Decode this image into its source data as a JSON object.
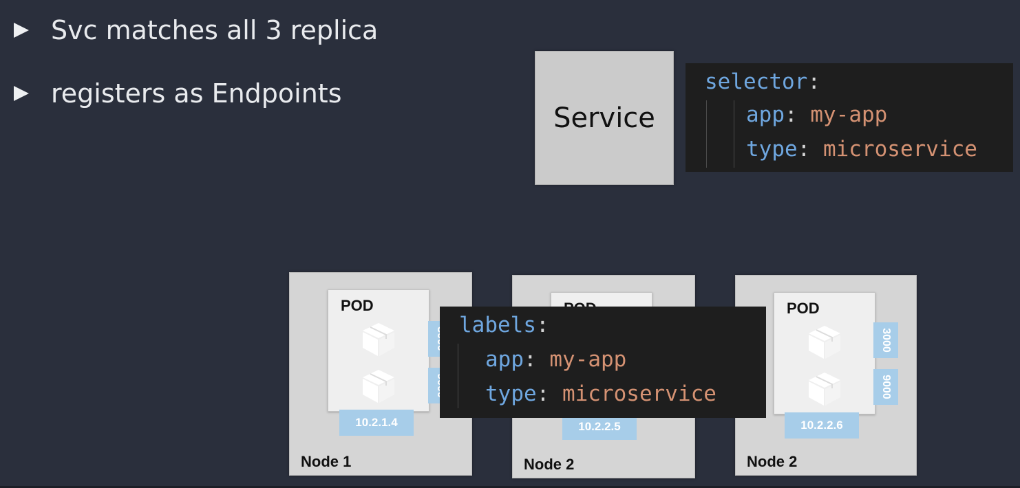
{
  "bullets": [
    {
      "text": "Svc matches all 3 replica"
    },
    {
      "text": "registers as Endpoints"
    }
  ],
  "service": {
    "label": "Service"
  },
  "selector_code": {
    "root_key": "selector",
    "app_key": "app",
    "app_value": "my-app",
    "type_key": "type",
    "type_value": "microservice"
  },
  "labels_code": {
    "root_key": "labels",
    "app_key": "app",
    "app_value": "my-app",
    "type_key": "type",
    "type_value": "microservice"
  },
  "nodes": [
    {
      "label": "Node 1",
      "pod": {
        "title": "POD",
        "ip": "10.2.1.4",
        "ports": [
          "3000",
          "9000"
        ]
      }
    },
    {
      "label": "Node 2",
      "pod": {
        "title": "POD",
        "ip": "10.2.2.5",
        "ports": []
      }
    },
    {
      "label": "Node 2",
      "pod": {
        "title": "POD",
        "ip": "10.2.2.6",
        "ports": [
          "3000",
          "9000"
        ]
      }
    }
  ],
  "colors": {
    "background": "#2a2f3c",
    "code_key": "#6fa7e0",
    "code_value": "#d59273",
    "port_fill": "#a7cde9"
  }
}
